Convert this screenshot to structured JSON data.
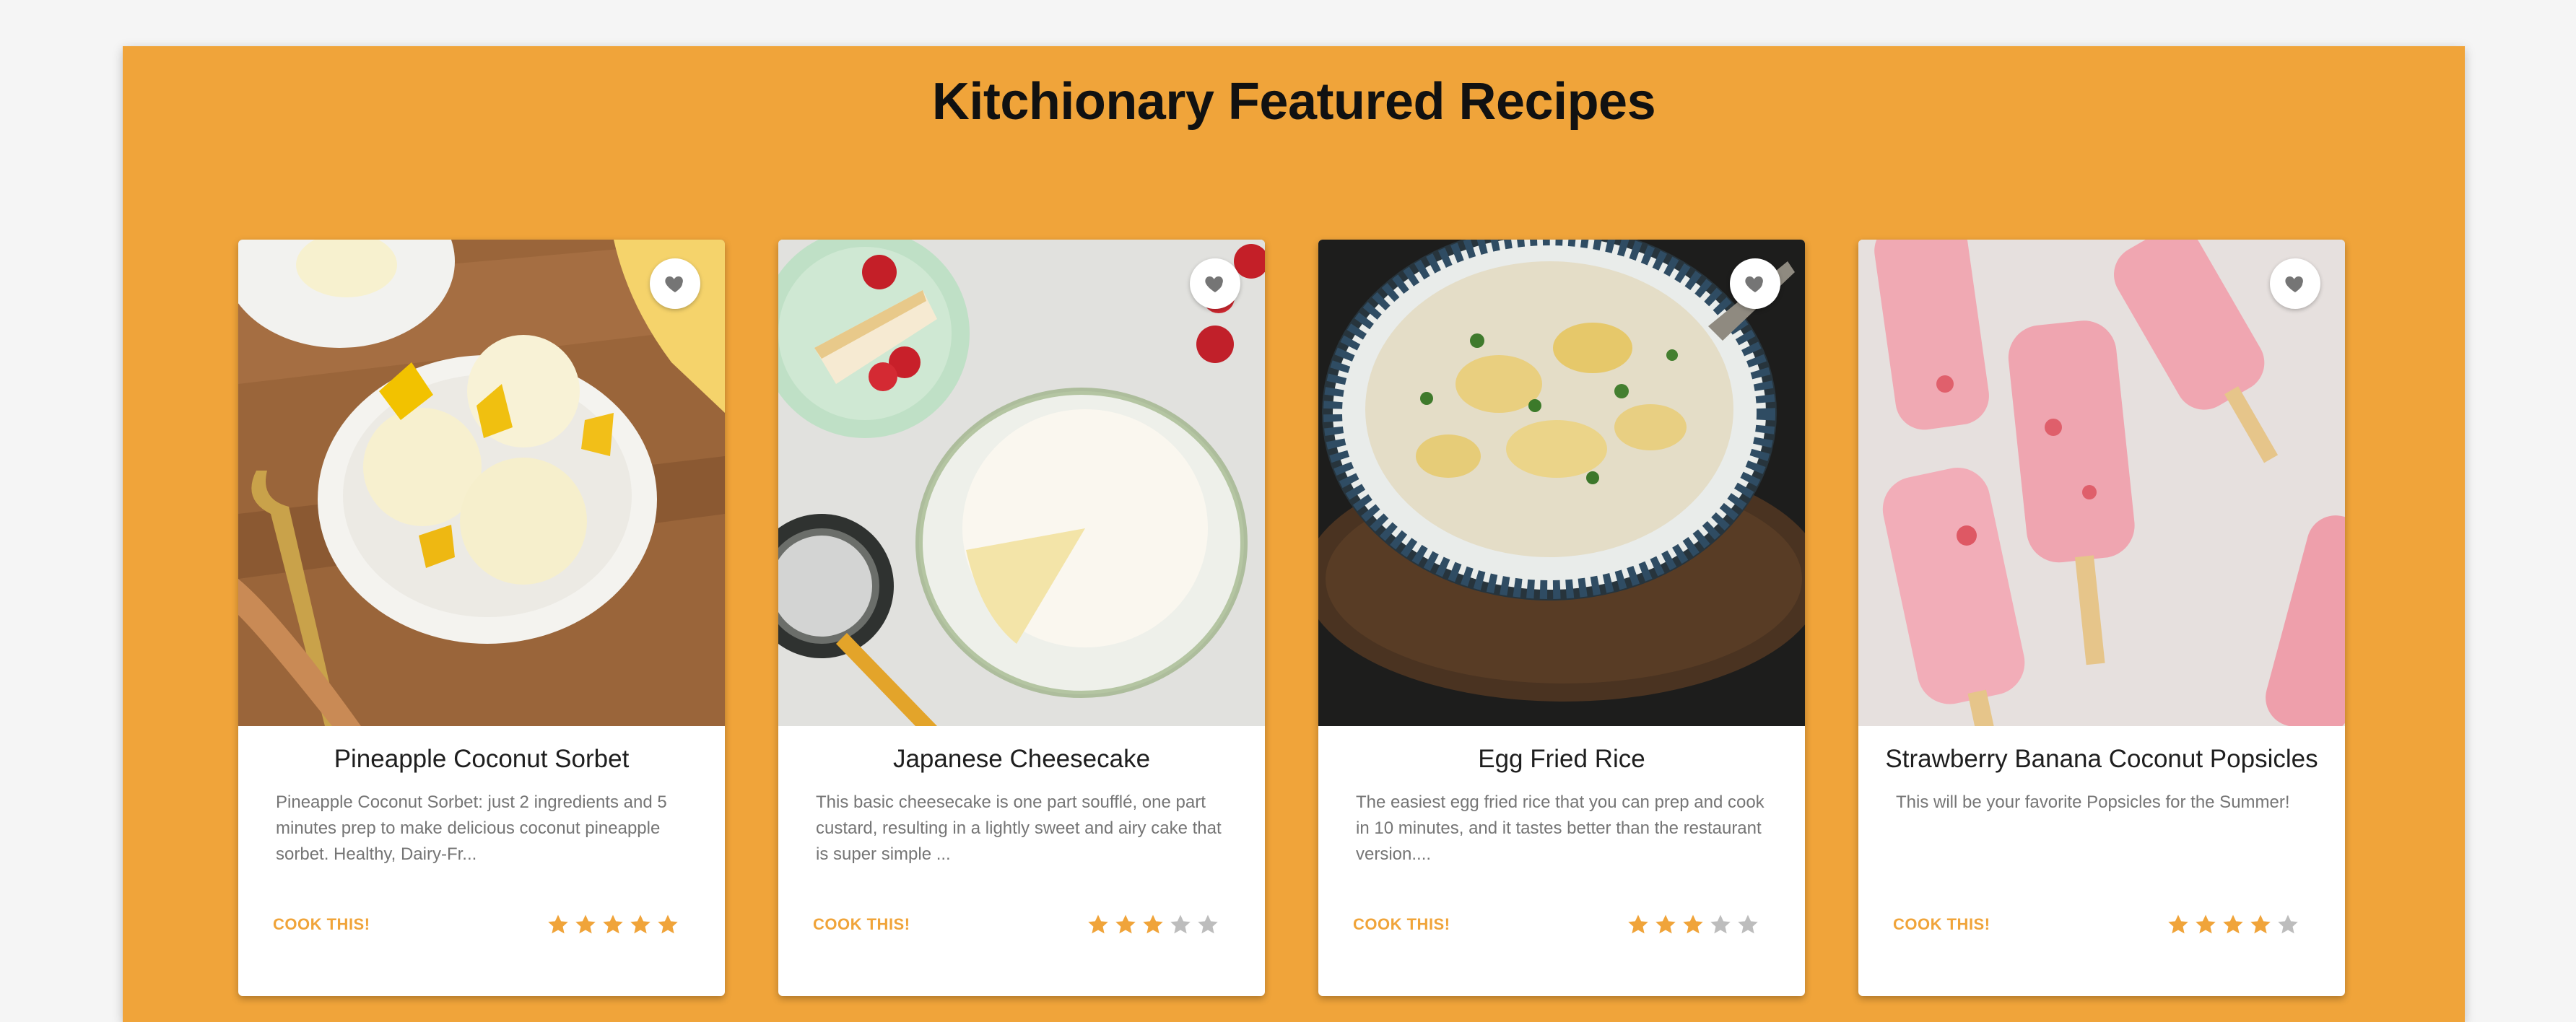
{
  "page": {
    "heading": "Kitchionary Featured Recipes",
    "accent_color": "#f0a43a",
    "star_empty_color": "#bdbdbd"
  },
  "recipes": [
    {
      "title": "Pineapple Coconut Sorbet",
      "description": "Pineapple Coconut Sorbet: just 2 ingredients and 5 minutes prep to make delicious coconut pineapple sorbet. Healthy, Dairy-Fr...",
      "action_label": "COOK THIS!",
      "rating": 5,
      "rating_max": 5,
      "favorite_icon": "heart-icon"
    },
    {
      "title": "Japanese Cheesecake",
      "description": "This basic cheesecake is one part soufflé, one part custard, resulting in a lightly sweet and airy cake that is super simple ...",
      "action_label": "COOK THIS!",
      "rating": 3,
      "rating_max": 5,
      "favorite_icon": "heart-icon"
    },
    {
      "title": "Egg Fried Rice",
      "description": "The easiest egg fried rice that you can prep and cook in 10 minutes, and it tastes better than the restaurant version....",
      "action_label": "COOK THIS!",
      "rating": 3,
      "rating_max": 5,
      "favorite_icon": "heart-icon"
    },
    {
      "title": "Strawberry Banana Coconut Popsicles",
      "description": "This will be your favorite Popsicles for the Summer!",
      "action_label": "COOK THIS!",
      "rating": 4,
      "rating_max": 5,
      "favorite_icon": "heart-icon"
    }
  ]
}
